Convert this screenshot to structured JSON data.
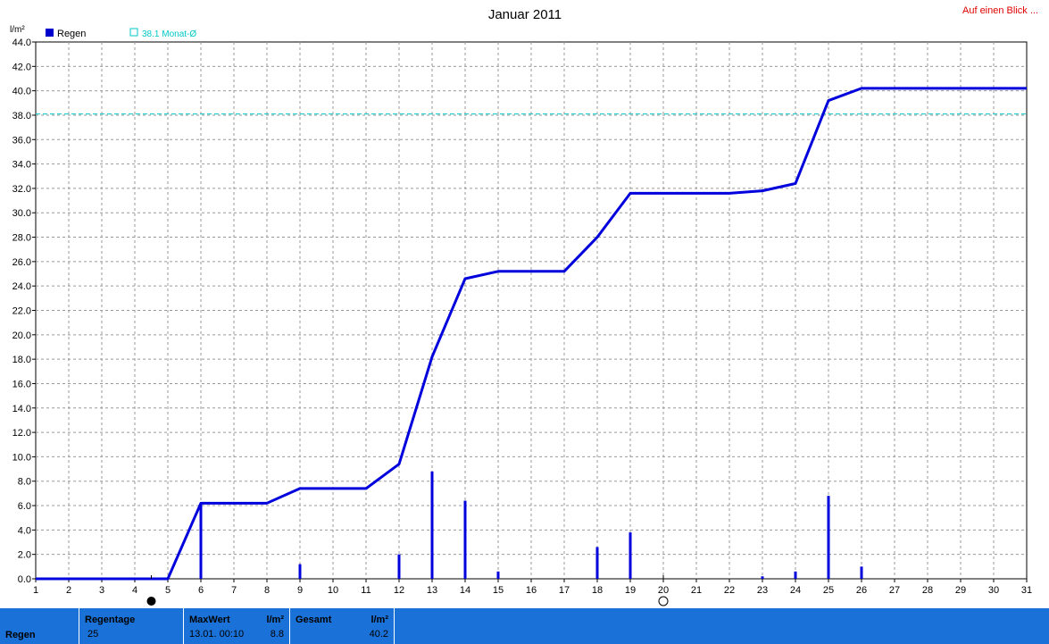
{
  "top_link": "Auf einen Blick ...",
  "chart_data": {
    "type": "line",
    "title": "Januar 2011",
    "ylabel": "l/m²",
    "ylim": [
      0,
      44
    ],
    "xlim": [
      1,
      31
    ],
    "grid": true,
    "x_ticks": [
      "1",
      "2",
      "3",
      "4",
      "5",
      "6",
      "7",
      "8",
      "9",
      "10",
      "11",
      "12",
      "13",
      "14",
      "15",
      "16",
      "17",
      "18",
      "19",
      "20",
      "21",
      "22",
      "23",
      "24",
      "25",
      "26",
      "27",
      "28",
      "29",
      "30",
      "31"
    ],
    "y_ticks": [
      "0.0",
      "2.0",
      "4.0",
      "6.0",
      "8.0",
      "10.0",
      "12.0",
      "14.0",
      "16.0",
      "18.0",
      "20.0",
      "22.0",
      "24.0",
      "26.0",
      "28.0",
      "30.0",
      "32.0",
      "34.0",
      "36.0",
      "38.0",
      "40.0",
      "42.0",
      "44.0"
    ],
    "legend": [
      {
        "label": "Regen",
        "color": "#0000cc"
      },
      {
        "label": "38.1 Monat-Ø",
        "color": "#00c8c8"
      }
    ],
    "reference_line": {
      "value": 38.1,
      "color": "#00c8c8"
    },
    "series": [
      {
        "name": "Regen",
        "kind": "cumulative",
        "color": "#0000dd",
        "x": [
          1,
          5,
          6,
          8,
          9,
          11,
          12,
          13,
          14,
          15,
          17,
          18,
          19,
          22,
          23,
          24,
          25,
          26,
          31
        ],
        "y": [
          0,
          0,
          6.2,
          6.2,
          7.4,
          7.4,
          9.4,
          18.2,
          24.6,
          25.2,
          25.2,
          28.0,
          31.6,
          31.6,
          31.8,
          32.4,
          39.2,
          40.2,
          40.2
        ]
      },
      {
        "name": "Regen",
        "kind": "daily_bars",
        "color": "#0000dd",
        "x": [
          6,
          9,
          12,
          13,
          14,
          15,
          18,
          19,
          23,
          24,
          25,
          26
        ],
        "y": [
          6.2,
          1.2,
          2.0,
          8.8,
          6.4,
          0.6,
          2.6,
          3.8,
          0.2,
          0.6,
          6.8,
          1.0
        ]
      }
    ],
    "moon_markers": [
      {
        "x": 4.5,
        "phase": "new-moon"
      },
      {
        "x": 20,
        "phase": "full-moon"
      }
    ]
  },
  "footer": {
    "row_label": "Regen",
    "regentage_label": "Regentage",
    "regentage_value": "25",
    "maxwert_label": "MaxWert",
    "maxwert_unit": "l/m²",
    "maxwert_time": "13.01.  00:10",
    "maxwert_value": "8.8",
    "gesamt_label": "Gesamt",
    "gesamt_unit": "l/m²",
    "gesamt_value": "40.2"
  }
}
